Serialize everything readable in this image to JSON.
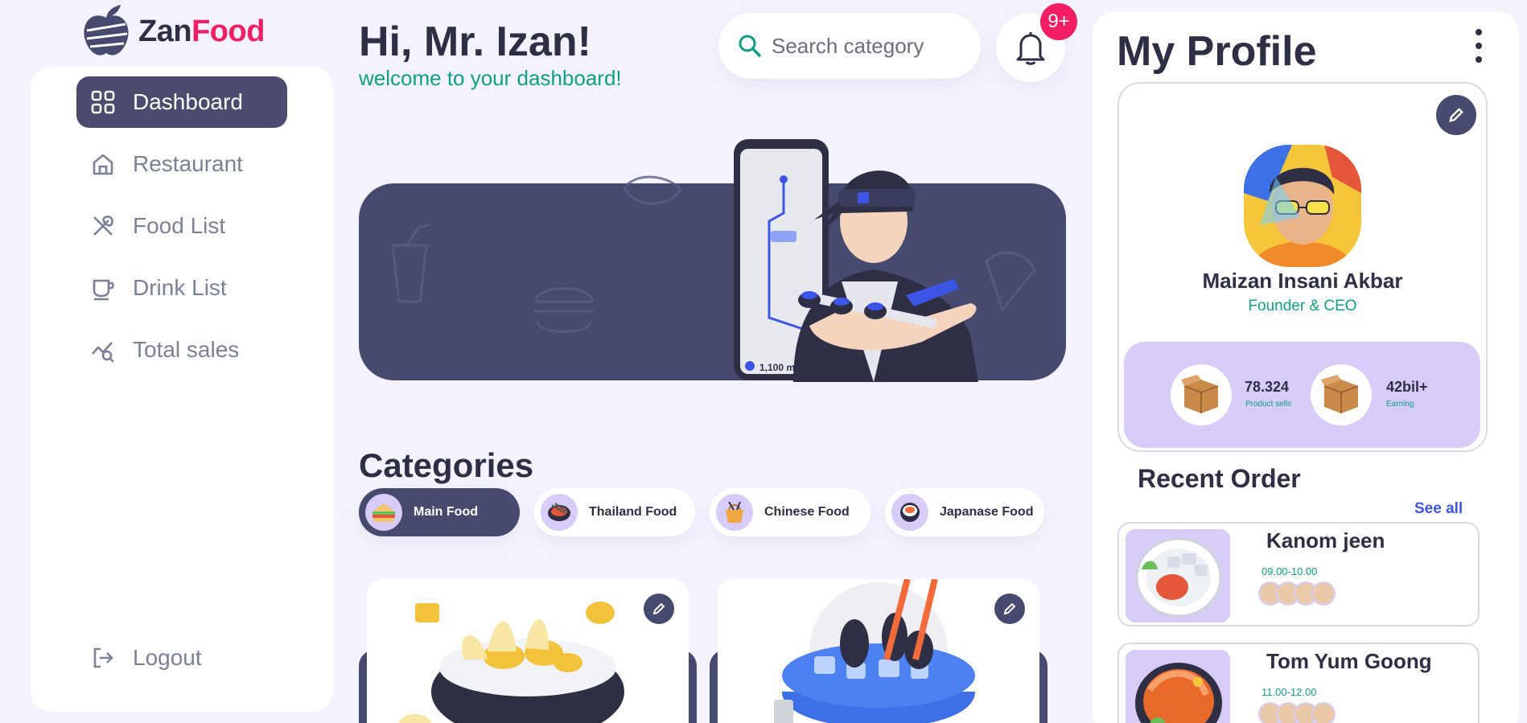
{
  "brand": {
    "name_part1": "Zan",
    "name_part2": "Food"
  },
  "sidebar": {
    "items": [
      {
        "label": "Dashboard",
        "icon": "grid-icon",
        "active": true
      },
      {
        "label": "Restaurant",
        "icon": "home-icon",
        "active": false
      },
      {
        "label": "Food List",
        "icon": "utensils-icon",
        "active": false
      },
      {
        "label": "Drink List",
        "icon": "cup-icon",
        "active": false
      },
      {
        "label": "Total sales",
        "icon": "chart-search-icon",
        "active": false
      }
    ],
    "logout_label": "Logout"
  },
  "header": {
    "greeting": "Hi, Mr. Izan!",
    "subtitle": "welcome to your dashboard!",
    "search_placeholder": "Search category",
    "notification_badge": "9+"
  },
  "banner": {
    "map_label": "1,100 m"
  },
  "categories": {
    "title": "Categories",
    "items": [
      {
        "label": "Main Food",
        "active": true
      },
      {
        "label": "Thailand Food",
        "active": false
      },
      {
        "label": "Chinese Food",
        "active": false
      },
      {
        "label": "Japanase Food",
        "active": false
      }
    ]
  },
  "profile": {
    "title": "My Profile",
    "name": "Maizan Insani Akbar",
    "role": "Founder & CEO",
    "stats": [
      {
        "value": "78.324",
        "label": "Product sells"
      },
      {
        "value": "42bil+",
        "label": "Earning"
      }
    ]
  },
  "recent_orders": {
    "title": "Recent Order",
    "see_all": "See all",
    "items": [
      {
        "name": "Kanom jeen",
        "time": "09.00-10.00"
      },
      {
        "name": "Tom Yum Goong",
        "time": "11.00-12.00"
      }
    ]
  },
  "colors": {
    "accent_dark": "#464a6f",
    "brand_pink": "#f21d63",
    "green": "#0ea085",
    "lavender": "#d6ccf7",
    "link_blue": "#3d55e6"
  }
}
